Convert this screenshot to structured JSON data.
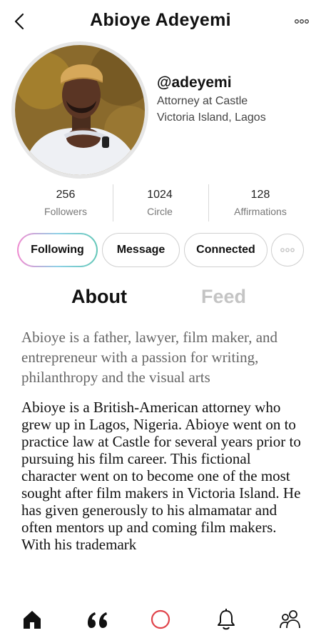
{
  "header": {
    "title": "Abioye Adeyemi",
    "back_icon": "chevron-left-icon",
    "more_icon": "more-horizontal-icon"
  },
  "profile": {
    "handle": "@adeyemi",
    "role": "Attorney at Castle",
    "location": "Victoria Island, Lagos",
    "avatar": "profile-photo"
  },
  "stats": [
    {
      "value": "256",
      "label": "Followers"
    },
    {
      "value": "1024",
      "label": "Circle"
    },
    {
      "value": "128",
      "label": "Affirmations"
    }
  ],
  "actions": {
    "following": "Following",
    "message": "Message",
    "connected": "Connected",
    "more": "•••"
  },
  "tabs": {
    "about": "About",
    "feed": "Feed",
    "active": "about"
  },
  "about": {
    "bio": "Abioye is a father, lawyer, film maker, and entrepreneur with a passion for writing, philanthropy and the visual arts",
    "description": "Abioye is a British-American attorney who  grew up in Lagos, Nigeria. Abioye went on to practice law at Castle for several years prior to pursuing his film career. This fictional character went on to become one of the most sought after film makers in Victoria Island. He has given generously to his almamatar and often mentors up and coming film makers. With his trademark"
  },
  "bottom_nav": [
    "home-icon",
    "quote-icon",
    "circle-icon",
    "bell-icon",
    "people-icon"
  ],
  "colors": {
    "accent_gradient": [
      "#f08bd0",
      "#8fd0e6",
      "#64c7b8"
    ],
    "record_red": "#e0434a",
    "muted": "#c4c4c4"
  }
}
